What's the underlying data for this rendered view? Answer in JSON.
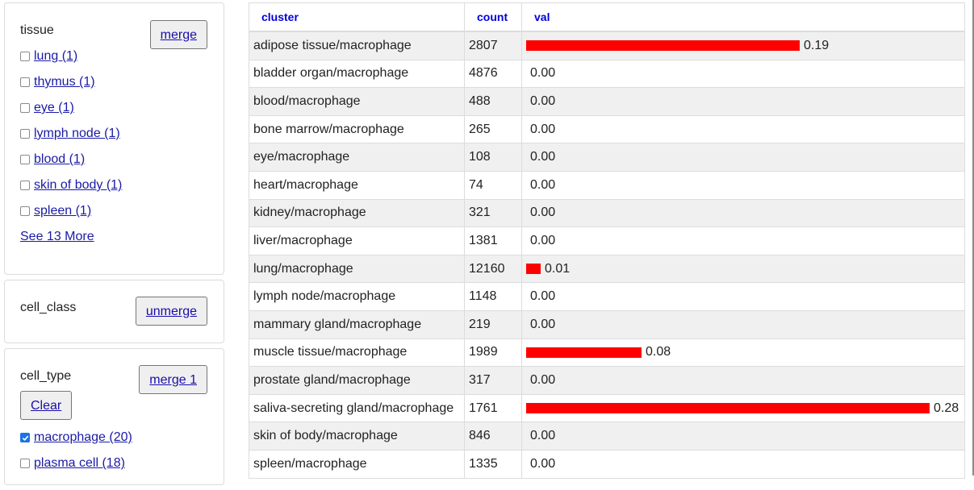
{
  "sidebar": {
    "tissue": {
      "title": "tissue",
      "button_label": "merge",
      "items": [
        {
          "label": "lung (1)",
          "checked": false
        },
        {
          "label": "thymus (1)",
          "checked": false
        },
        {
          "label": "eye (1)",
          "checked": false
        },
        {
          "label": "lymph node (1)",
          "checked": false
        },
        {
          "label": "blood (1)",
          "checked": false
        },
        {
          "label": "skin of body (1)",
          "checked": false
        },
        {
          "label": "spleen (1)",
          "checked": false
        }
      ],
      "see_more": "See 13 More"
    },
    "cell_class": {
      "title": "cell_class",
      "button_label": "unmerge"
    },
    "cell_type": {
      "title": "cell_type",
      "button_label": "merge 1",
      "clear_label": "Clear",
      "items": [
        {
          "label": "macrophage (20)",
          "checked": true
        },
        {
          "label": "plasma cell (18)",
          "checked": false
        }
      ]
    }
  },
  "table": {
    "headers": [
      "cluster",
      "count",
      "val"
    ],
    "bar_color": "#ff0000",
    "bar_max": 0.28,
    "rows": [
      {
        "cluster": "adipose tissue/macrophage",
        "count": "2807",
        "val": 0.19,
        "val_text": "0.19"
      },
      {
        "cluster": "bladder organ/macrophage",
        "count": "4876",
        "val": 0,
        "val_text": "0.00"
      },
      {
        "cluster": "blood/macrophage",
        "count": "488",
        "val": 0,
        "val_text": "0.00"
      },
      {
        "cluster": "bone marrow/macrophage",
        "count": "265",
        "val": 0,
        "val_text": "0.00"
      },
      {
        "cluster": "eye/macrophage",
        "count": "108",
        "val": 0,
        "val_text": "0.00"
      },
      {
        "cluster": "heart/macrophage",
        "count": "74",
        "val": 0,
        "val_text": "0.00"
      },
      {
        "cluster": "kidney/macrophage",
        "count": "321",
        "val": 0,
        "val_text": "0.00"
      },
      {
        "cluster": "liver/macrophage",
        "count": "1381",
        "val": 0,
        "val_text": "0.00"
      },
      {
        "cluster": "lung/macrophage",
        "count": "12160",
        "val": 0.01,
        "val_text": "0.01"
      },
      {
        "cluster": "lymph node/macrophage",
        "count": "1148",
        "val": 0,
        "val_text": "0.00"
      },
      {
        "cluster": "mammary gland/macrophage",
        "count": "219",
        "val": 0,
        "val_text": "0.00"
      },
      {
        "cluster": "muscle tissue/macrophage",
        "count": "1989",
        "val": 0.08,
        "val_text": "0.08"
      },
      {
        "cluster": "prostate gland/macrophage",
        "count": "317",
        "val": 0,
        "val_text": "0.00"
      },
      {
        "cluster": "saliva-secreting gland/macrophage",
        "count": "1761",
        "val": 0.28,
        "val_text": "0.28"
      },
      {
        "cluster": "skin of body/macrophage",
        "count": "846",
        "val": 0,
        "val_text": "0.00"
      },
      {
        "cluster": "spleen/macrophage",
        "count": "1335",
        "val": 0,
        "val_text": "0.00"
      }
    ]
  }
}
